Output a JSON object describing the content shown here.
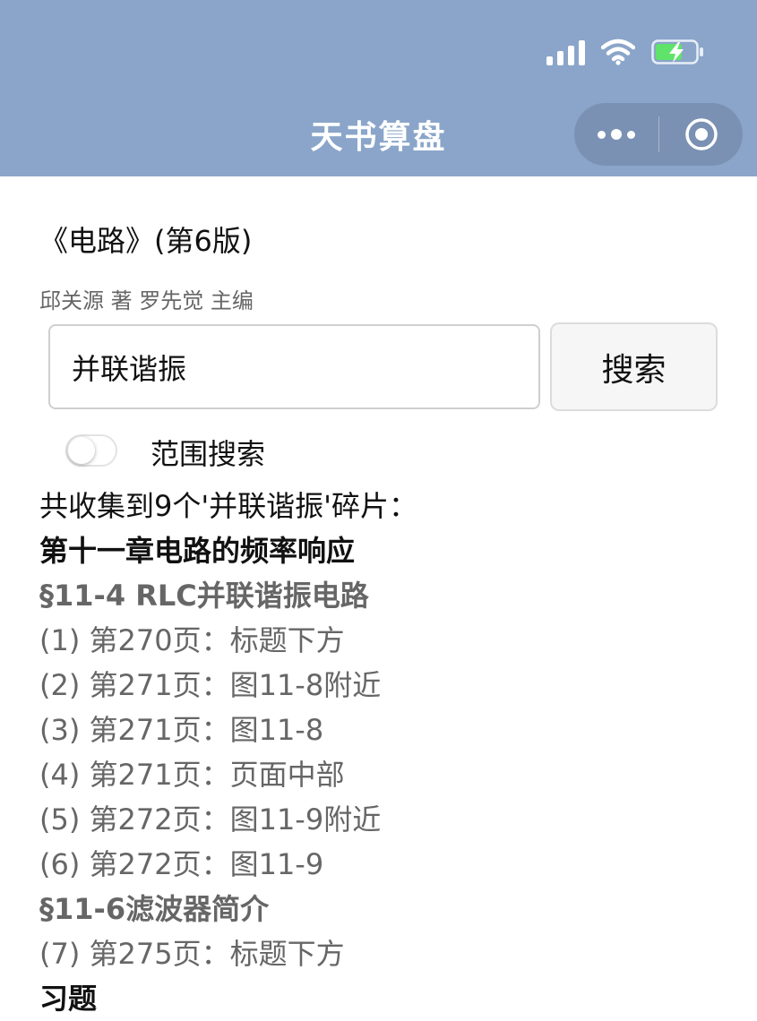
{
  "status_bar": {
    "signal_icon": "signal-icon",
    "wifi_icon": "wifi-icon",
    "battery_icon": "battery-charging-icon",
    "battery_color": "#5fe36a"
  },
  "nav": {
    "title": "天书算盘",
    "background_color": "#8aa5c9",
    "more_icon": "more-icon",
    "close_icon": "target-icon"
  },
  "book": {
    "title": "《电路》(第6版)",
    "author": "邱关源 著 罗先觉 主编"
  },
  "search": {
    "value": "并联谐振",
    "button_label": "搜索"
  },
  "range_toggle": {
    "label": "范围搜索",
    "on": false
  },
  "results": {
    "summary": "共收集到9个'并联谐振'碎片：",
    "chapter": "第十一章电路的频率响应",
    "sections": [
      {
        "title": "§11-4 RLC并联谐振电路",
        "items": [
          "(1) 第270页：标题下方",
          "(2) 第271页：图11-8附近",
          "(3) 第271页：图11-8",
          "(4) 第271页：页面中部",
          "(5) 第272页：图11-9附近",
          "(6) 第272页：图11-9"
        ]
      },
      {
        "title": "§11-6滤波器简介",
        "items": [
          "(7) 第275页：标题下方"
        ]
      },
      {
        "title": "习题",
        "items": []
      }
    ]
  }
}
